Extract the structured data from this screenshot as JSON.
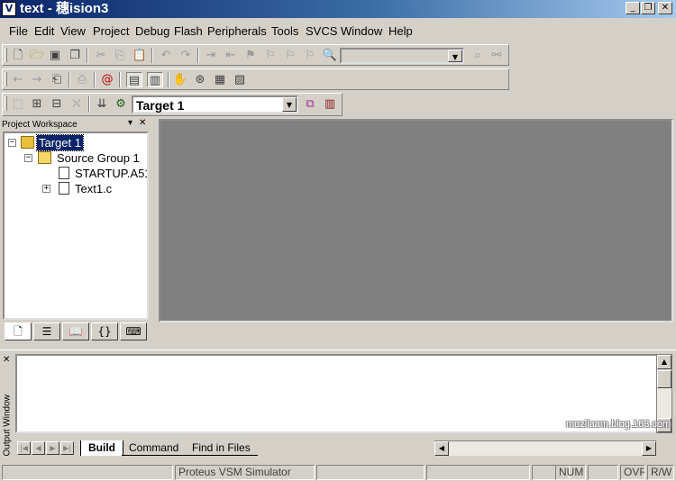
{
  "window": {
    "icon_letter": "V",
    "title": "text  - 穗ision3",
    "min": "_",
    "max": "❐",
    "close": "✕"
  },
  "menu": [
    "File",
    "Edit",
    "View",
    "Project",
    "Debug",
    "Flash",
    "Peripherals",
    "Tools",
    "SVCS",
    "Window",
    "Help"
  ],
  "toolbar": {
    "find_combo_value": "",
    "target_combo_value": "Target 1"
  },
  "workspace": {
    "title": "Project Workspace",
    "pin": "▾",
    "close": "✕",
    "tree": [
      {
        "label": "Target 1",
        "box": "−",
        "selected": true
      },
      {
        "label": "Source Group 1",
        "box": "−"
      },
      {
        "label": "STARTUP.A51"
      },
      {
        "label": "Text1.c",
        "box": "+"
      }
    ],
    "tabs": [
      "files-tab",
      "regs-tab",
      "books-tab",
      "functions-tab",
      "templates-tab"
    ]
  },
  "output": {
    "label": "Output Window",
    "close": "✕",
    "tabs": [
      "Build",
      "Command",
      "Find in Files"
    ],
    "active_tab": "Build"
  },
  "status": {
    "simulator": "Proteus VSM Simulator",
    "num": "NUM",
    "ovr": "OVR",
    "rw": "R/W"
  },
  "watermark": "mozilaam.blog.163.com"
}
